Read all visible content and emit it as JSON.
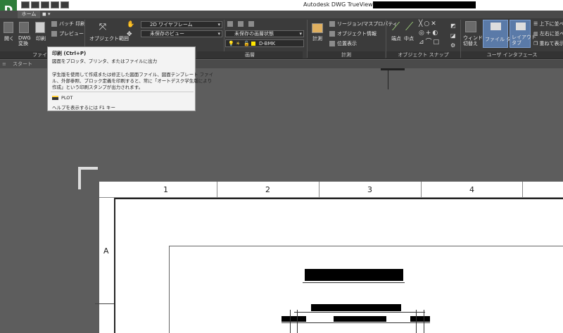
{
  "window": {
    "app_letter": "D",
    "title": "Autodesk DWG TrueView 2017"
  },
  "tabs": {
    "home": "ホーム"
  },
  "ribbon": {
    "file": {
      "open": "開く",
      "dwg_convert": "DWG\n変換",
      "print": "印刷",
      "batch_print": "バッチ 印刷",
      "preview": "プレビュー",
      "panel": "ファイル"
    },
    "view": {
      "object_range": "オブジェクト範囲",
      "visual_style": "2D ワイヤフレーム",
      "named_view": "未保存のビュー",
      "view_manager": "ビュー管理"
    },
    "layers": {
      "layer_state": "未保存の画層状態",
      "layer_name": "D-BMK",
      "panel": "画層"
    },
    "measure": {
      "region_mass": "リージョン/マスプロパティ",
      "object_info": "オブジェクト情報",
      "position": "位置表示",
      "measure": "計測",
      "panel": "計測"
    },
    "osnap": {
      "endpoint": "端点",
      "midpoint": "中点",
      "panel": "オブジェクト スナップ"
    },
    "ui": {
      "window_switch": "ウィンドウ\n切替え",
      "file_tab": "ファイル タブ",
      "layout_tab": "レイアウト\nタブ",
      "tile_h": "上下に並べて",
      "tile_v": "左右に並べて",
      "cascade": "重ねて表示",
      "panel": "ユーザ インタフェース"
    }
  },
  "file_tabs": {
    "start": "スタート"
  },
  "tooltip": {
    "title": "印刷 (Ctrl+P)",
    "summary": "図面をプロッタ、プリンタ、またはファイルに出力",
    "body1": "学生版を使用して作成または修正した図面ファイル、図面テンプレート ファイ",
    "body2": "ル、外部参照、ブロック定義を印刷すると、常に「オートデスク学生版により",
    "body3": "作成」という印刷スタンプが出力されます。",
    "command": "PLOT",
    "help": "ヘルプを表示するには F1 キー"
  },
  "drawing": {
    "columns": [
      "1",
      "2",
      "3",
      "4"
    ],
    "row_label": "A"
  },
  "colors": {
    "app_green": "#2e7d3a",
    "ribbon_dark": "#3b3b3b",
    "canvas_gray": "#5d5d5d"
  }
}
